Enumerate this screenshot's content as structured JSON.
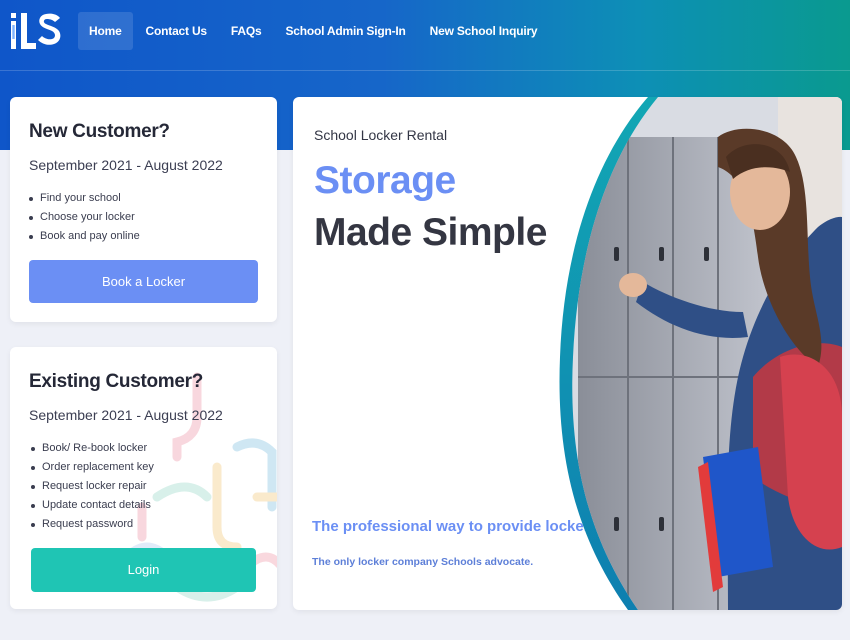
{
  "nav": {
    "logo_text": "ILS",
    "items": [
      {
        "label": "Home",
        "active": true
      },
      {
        "label": "Contact Us"
      },
      {
        "label": "FAQs"
      },
      {
        "label": "School Admin Sign-In"
      },
      {
        "label": "New School Inquiry"
      }
    ]
  },
  "new_customer": {
    "title": "New Customer?",
    "period": "September 2021 - August 2022",
    "items": [
      "Find your school",
      "Choose your locker",
      "Book and pay online"
    ],
    "button_label": "Book a Locker"
  },
  "existing_customer": {
    "title": "Existing Customer?",
    "period": "September 2021 - August 2022",
    "items": [
      "Book/ Re-book locker",
      "Order replacement key",
      "Request locker repair",
      "Update contact details",
      "Request password"
    ],
    "button_label": "Login"
  },
  "hero": {
    "kicker": "School Locker Rental",
    "headline_accent": "Storage",
    "headline": "Made Simple",
    "tagline": "The professional way to provide lockers.",
    "subtagline": "The only locker company Schools advocate."
  },
  "colors": {
    "accent_blue": "#6b8ff4",
    "accent_teal": "#1fc5b4",
    "nav_gradient_start": "#0f56c9",
    "nav_gradient_end": "#0a9a8f"
  }
}
